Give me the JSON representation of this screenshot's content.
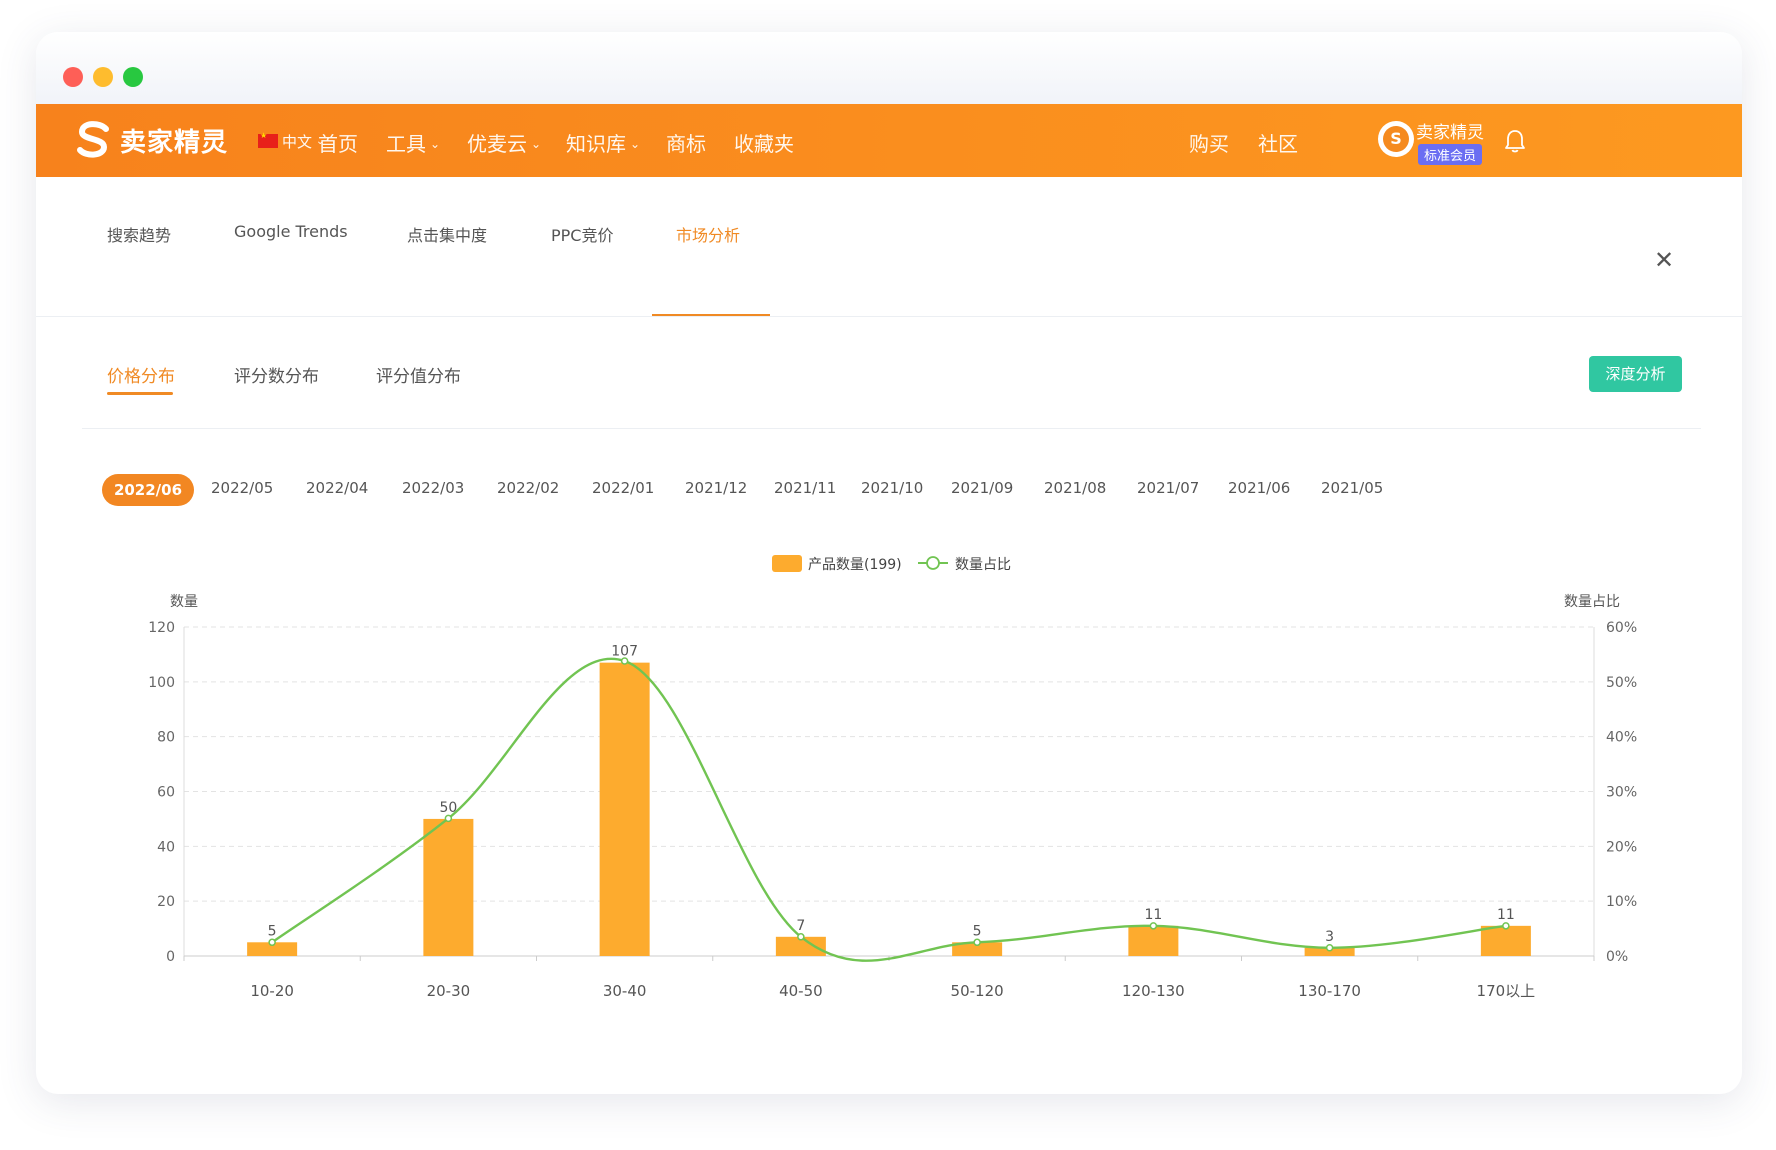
{
  "app": {
    "logo_text": "卖家精灵",
    "language": "中文",
    "nav": [
      {
        "label": "首页",
        "has_dropdown": false
      },
      {
        "label": "工具",
        "has_dropdown": true
      },
      {
        "label": "优麦云",
        "has_dropdown": true
      },
      {
        "label": "知识库",
        "has_dropdown": true
      },
      {
        "label": "商标",
        "has_dropdown": false
      },
      {
        "label": "收藏夹",
        "has_dropdown": false
      }
    ],
    "right_nav": [
      "购买",
      "社区"
    ],
    "user": {
      "name": "卖家精灵",
      "badge": "标准会员",
      "avatar_glyph": "S"
    }
  },
  "analysis_tabs": [
    "搜索趋势",
    "Google Trends",
    "点击集中度",
    "PPC竞价",
    "市场分析"
  ],
  "active_analysis_tab": "市场分析",
  "sub_tabs": [
    "价格分布",
    "评分数分布",
    "评分值分布"
  ],
  "active_sub_tab": "价格分布",
  "deep_button": "深度分析",
  "close_glyph": "✕",
  "months": [
    "2022/06",
    "2022/05",
    "2022/04",
    "2022/03",
    "2022/02",
    "2022/01",
    "2021/12",
    "2021/11",
    "2021/10",
    "2021/09",
    "2021/08",
    "2021/07",
    "2021/06",
    "2021/05"
  ],
  "active_month": "2022/06",
  "colors": {
    "brand": "#f7821c",
    "accent": "#f08a24",
    "bar": "#fdab2e",
    "line": "#71c452",
    "button": "#30c7a1",
    "badge": "#6b6ef2"
  },
  "chart_data": {
    "type": "bar",
    "categories": [
      "10-20",
      "20-30",
      "30-40",
      "40-50",
      "50-120",
      "120-130",
      "130-170",
      "170以上"
    ],
    "series": [
      {
        "name": "产品数量(199)",
        "type": "bar",
        "axis": "left",
        "values": [
          5,
          50,
          107,
          7,
          5,
          11,
          3,
          11
        ]
      },
      {
        "name": "数量占比",
        "type": "line",
        "axis": "right",
        "values": [
          2.5,
          25.1,
          53.8,
          3.5,
          2.5,
          5.5,
          1.5,
          5.5
        ]
      }
    ],
    "ylabel": "数量",
    "ylabel_right": "数量占比",
    "ylim": [
      0,
      120
    ],
    "yticks": [
      0,
      20,
      40,
      60,
      80,
      100,
      120
    ],
    "ylim_right": [
      0,
      60
    ],
    "yticks_right": [
      "0%",
      "10%",
      "20%",
      "30%",
      "40%",
      "50%",
      "60%"
    ],
    "legend_position": "top-center",
    "grid": true
  }
}
